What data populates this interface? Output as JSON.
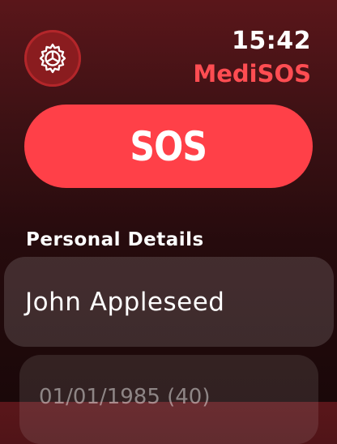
{
  "header": {
    "time": "15:42",
    "app_title": "MediSOS",
    "settings_icon": "gear-icon"
  },
  "sos": {
    "label": "SOS",
    "color": "#ff4048"
  },
  "personal_details": {
    "section_title": "Personal Details",
    "name": "John Appleseed",
    "date_of_birth": "01/01/1985 (40)"
  },
  "colors": {
    "accent": "#ff4d52",
    "background_top": "#5a161a",
    "background_bottom": "#1a0809"
  }
}
